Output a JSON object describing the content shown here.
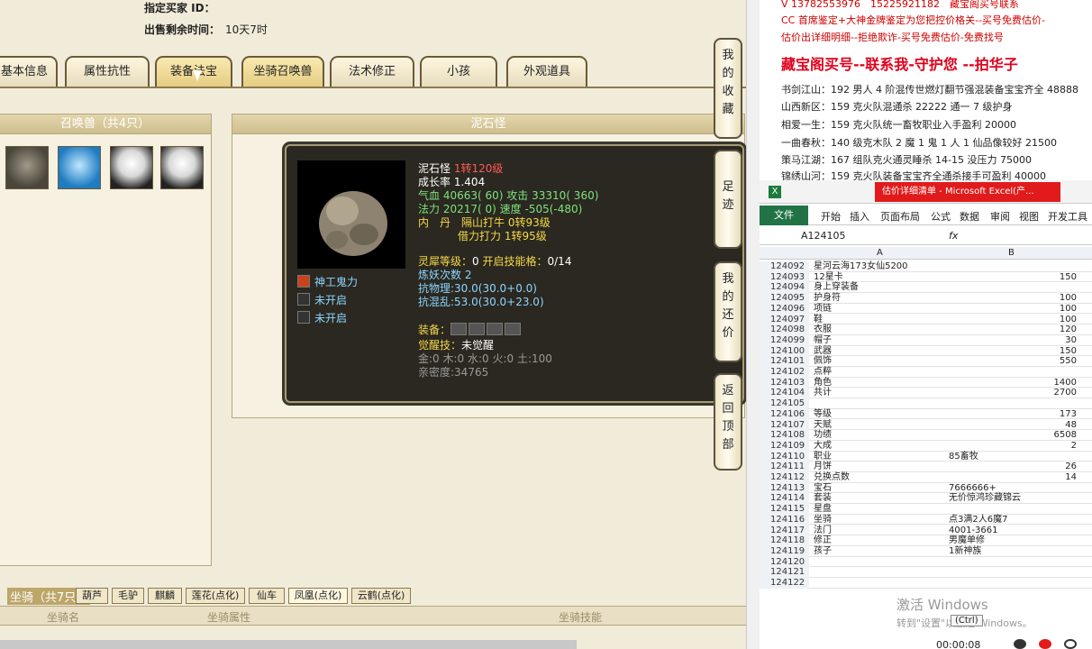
{
  "header": {
    "buyer_id_label": "指定买家 ID：",
    "sale_time_label": "出售剩余时间：",
    "sale_time_value": "10天7时"
  },
  "tabs": [
    {
      "label": "基本信息"
    },
    {
      "label": "属性抗性"
    },
    {
      "label": "装备法宝"
    },
    {
      "label": "坐骑召唤兽"
    },
    {
      "label": "法术修正"
    },
    {
      "label": "小孩"
    },
    {
      "label": "外观道具"
    }
  ],
  "summon_panel": {
    "title": "召唤兽（共4只）"
  },
  "detail_panel": {
    "title": "泥石怪"
  },
  "pet": {
    "name": "泥石怪",
    "level": "1转120级",
    "growth_label": "成长率",
    "growth": "1.404",
    "hp_label": "气血",
    "hp": "40663( 60)",
    "atk_label": "攻击",
    "atk": "33310( 360)",
    "mp_label": "法力",
    "mp": "20217( 0)",
    "spd_label": "速度",
    "spd": "-505(-480)",
    "neidan_label": "内　丹",
    "neidan1": "隔山打牛 0转93级",
    "neidan2": "借力打力 1转95级",
    "spirit_label": "灵犀等级：",
    "spirit_value": "0",
    "spirit_skill_label": "开启技能格：",
    "spirit_skill_value": "0/14",
    "refine_label": "炼妖次数",
    "refine_value": "2",
    "phys_res_label": "抗物理:",
    "phys_res_value": "30.0(30.0+0.0)",
    "chaos_res_label": "抗混乱:",
    "chaos_res_value": "53.0(30.0+23.0)",
    "equip_label": "装备：",
    "awaken_label": "觉醒技：",
    "awaken_value": "未觉醒",
    "elements": "金:0  木:0  水:0  火:0  土:100",
    "intimacy": "亲密度:34765",
    "skills": [
      "神工鬼力",
      "未开启",
      "未开启"
    ]
  },
  "side_buttons": [
    {
      "label": "我的收藏"
    },
    {
      "label": "足迹"
    },
    {
      "label": "我的还价"
    },
    {
      "label": "返回顶部"
    }
  ],
  "mount": {
    "title": "坐骑（共7只）",
    "tabs": [
      "葫芦",
      "毛驴",
      "麒麟",
      "莲花(点化)",
      "仙车",
      "凤凰(点化)",
      "云鹤(点化)"
    ],
    "cols": [
      "坐骑名",
      "坐骑属性",
      "坐骑技能"
    ]
  },
  "right_text": {
    "line1": "V 13782553976　15225921182　藏宝阁买号联系",
    "line2": "CC 首席鉴定+大神金牌鉴定为您把控价格关--买号免费估价-",
    "line3": "估价出详细明细--拒绝欺诈-买号免费估价-免费找号",
    "banner": "藏宝阁买号--联系我-守护您 --拍华子",
    "deals": [
      "书剑江山：192 男人 4 阶混传世燃灯翻节强混装备宝宝齐全 48888",
      "山西新区：159 克火队混通杀 22222 通一 7 级护身",
      "相爱一生：159 克火队统一畜牧职业入手盈利 20000",
      "一曲春秋：140 级克木队 2 魔 1 鬼 1 人 1 仙品像较好 21500",
      "策马江湖：167 组队克火通灵睡杀 14-15 没压力 75000",
      "锦绣山河：159 克火队装备宝宝齐全通杀接手可盈利 40000"
    ]
  },
  "excel": {
    "title": "估价详细清单 - Microsoft Excel(产...",
    "ribbon": [
      "文件",
      "开始",
      "插入",
      "页面布局",
      "公式",
      "数据",
      "审阅",
      "视图",
      "开发工具"
    ],
    "namebox": "A124105",
    "fx": "fx",
    "col_a": "A",
    "col_b": "B",
    "rows": [
      {
        "n": "124092",
        "a": "星河云海173女仙5200",
        "b": ""
      },
      {
        "n": "124093",
        "a": "12星卡",
        "b": "150"
      },
      {
        "n": "124094",
        "a": "身上穿装备",
        "b": ""
      },
      {
        "n": "124095",
        "a": "护身符",
        "b": "100"
      },
      {
        "n": "124096",
        "a": "项链",
        "b": "100"
      },
      {
        "n": "124097",
        "a": "鞋",
        "b": "100"
      },
      {
        "n": "124098",
        "a": "衣服",
        "b": "120"
      },
      {
        "n": "124099",
        "a": "帽子",
        "b": "30"
      },
      {
        "n": "124100",
        "a": "武器",
        "b": "150"
      },
      {
        "n": "124101",
        "a": "佩饰",
        "b": "550"
      },
      {
        "n": "124102",
        "a": "点粹",
        "b": ""
      },
      {
        "n": "124103",
        "a": "角色",
        "b": "1400"
      },
      {
        "n": "124104",
        "a": "共计",
        "b": "2700"
      },
      {
        "n": "124105",
        "a": "",
        "b": ""
      },
      {
        "n": "124106",
        "a": "等级",
        "b": "173"
      },
      {
        "n": "124107",
        "a": "天赋",
        "b": "48"
      },
      {
        "n": "124108",
        "a": "功绩",
        "b": "6508"
      },
      {
        "n": "124109",
        "a": "大成",
        "b": "2"
      },
      {
        "n": "124110",
        "a": "职业",
        "b": "85畜牧",
        "t": true
      },
      {
        "n": "124111",
        "a": "月饼",
        "b": "26"
      },
      {
        "n": "124112",
        "a": "兑换点数",
        "b": "14"
      },
      {
        "n": "124113",
        "a": "宝石",
        "b": "7666666+",
        "t": true
      },
      {
        "n": "124114",
        "a": "套装",
        "b": "无价惊鸿珍藏锦云",
        "t": true
      },
      {
        "n": "124115",
        "a": "星盘",
        "b": "",
        "t": true
      },
      {
        "n": "124116",
        "a": "坐骑",
        "b": "点3满2人6魔7",
        "t": true
      },
      {
        "n": "124117",
        "a": "法门",
        "b": "4001-3661",
        "t": true
      },
      {
        "n": "124118",
        "a": "修正",
        "b": "男魔单修",
        "t": true
      },
      {
        "n": "124119",
        "a": "孩子",
        "b": "1新神族",
        "t": true
      },
      {
        "n": "124120",
        "a": "",
        "b": ""
      },
      {
        "n": "124121",
        "a": "",
        "b": ""
      },
      {
        "n": "124122",
        "a": "",
        "b": ""
      }
    ],
    "watermark1": "激活 Windows",
    "watermark2": "转到\"设置\"以激活 Windows。",
    "paste": "(Ctrl)",
    "timer": "00:00:08"
  }
}
